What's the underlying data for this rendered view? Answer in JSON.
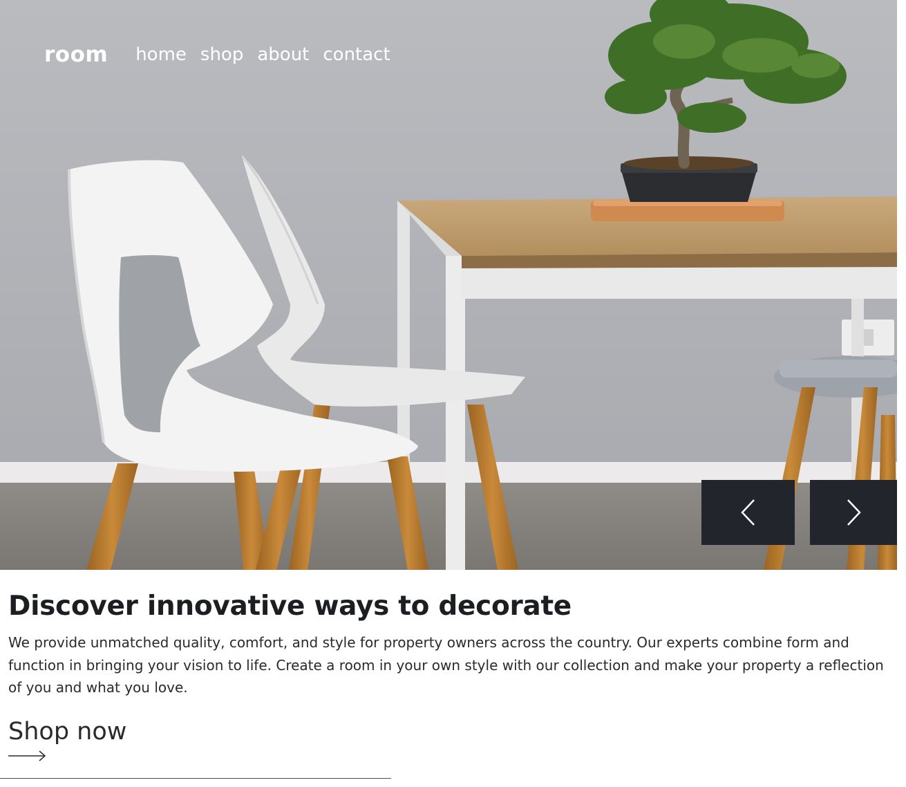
{
  "header": {
    "logo": "room",
    "nav": [
      {
        "label": "home"
      },
      {
        "label": "shop"
      },
      {
        "label": "about"
      },
      {
        "label": "contact"
      }
    ]
  },
  "hero": {
    "image": "dining-chairs-table-bonsai",
    "prev_icon": "chevron-left-icon",
    "next_icon": "chevron-right-icon"
  },
  "main": {
    "title": "Discover innovative ways to decorate",
    "description": "We provide unmatched quality, comfort, and style for property owners across the country. Our experts combine form and function in bringing your vision to life. Create a room in your own style with our collection and make your property a reflection of you and what you love.",
    "cta_label": "Shop now",
    "cta_icon": "arrow-right-icon"
  },
  "colors": {
    "nav_text": "#ffffff",
    "slider_button_bg": "#22252b",
    "heading": "#1c1e22",
    "body_text": "#2a2a2a"
  }
}
